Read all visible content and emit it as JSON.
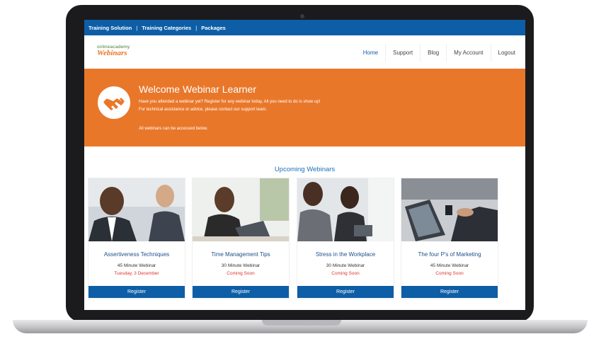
{
  "topnav": {
    "items": [
      "Training Solution",
      "Training Categories",
      "Packages"
    ],
    "separator": "|"
  },
  "logo": {
    "top": "onlineacademy",
    "bottom": "Webinars"
  },
  "menu": [
    "Home",
    "Support",
    "Blog",
    "My Account",
    "Logout"
  ],
  "banner": {
    "title": "Welcome Webinar Learner",
    "lines": [
      "Have you attended a webinar yet? Register for any webinar today. All you need to do is show up!",
      "For technical assistance or advice, please contact our support team.",
      "All webinars can be accessed below."
    ]
  },
  "section": {
    "title": "Upcoming Webinars"
  },
  "webinars": [
    {
      "title": "Assertiveness Techniques",
      "duration": "45 Minute Webinar",
      "date": "Tuesday, 3 December",
      "button": "Register"
    },
    {
      "title": "Time Management Tips",
      "duration": "30 Minute Webinar",
      "date": "Coming Soon",
      "button": "Register"
    },
    {
      "title": "Stress in the Workplace",
      "duration": "30 Minute Webinar",
      "date": "Coming Soon",
      "button": "Register"
    },
    {
      "title": "The four P's of Marketing",
      "duration": "45 Minute Webinar",
      "date": "Coming Soon",
      "button": "Register"
    }
  ],
  "colors": {
    "primary": "#0d5ea6",
    "accent": "#e9772a",
    "alert": "#e0322b"
  }
}
